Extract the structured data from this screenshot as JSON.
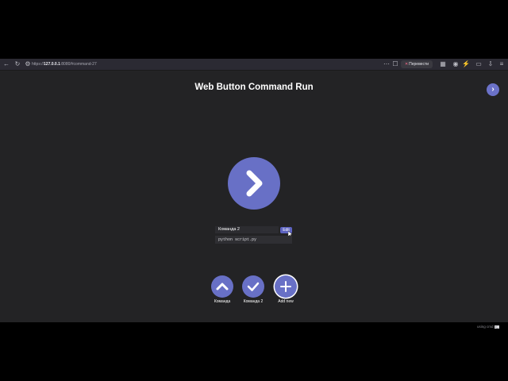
{
  "browser": {
    "url_prefix": "https://",
    "url_host": "127.0.0.1",
    "url_rest": ":8080/#command-27",
    "translate_label": "Перевести"
  },
  "page": {
    "title": "Web Button Command Run",
    "current_command": {
      "name": "Команда 2",
      "edit_label": "Edit",
      "command": "python script.py"
    },
    "buttons": [
      {
        "label": "Команда",
        "icon": "chevron-up-icon"
      },
      {
        "label": "Команда 2",
        "icon": "check-icon"
      },
      {
        "label": "Add new",
        "icon": "plus-icon"
      }
    ],
    "footer": {
      "text": "using cmd",
      "badge": ">_"
    }
  },
  "colors": {
    "accent": "#6870c6",
    "background": "#232325",
    "toolbar": "#2b2a33"
  }
}
